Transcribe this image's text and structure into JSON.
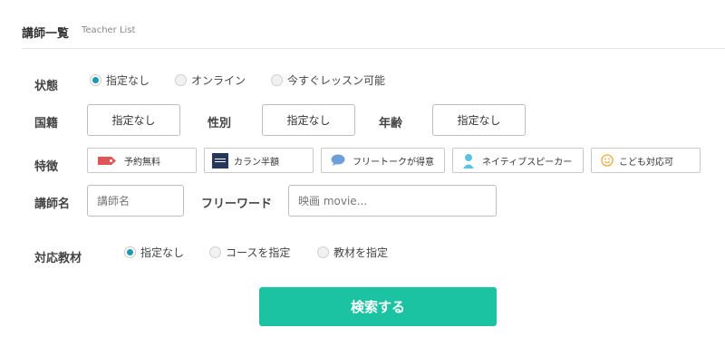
{
  "header": {
    "title": "講師一覧",
    "subtitle": "Teacher List"
  },
  "status": {
    "label": "状態",
    "options": [
      {
        "label": "指定なし",
        "checked": true
      },
      {
        "label": "オンライン",
        "checked": false
      },
      {
        "label": "今すぐレッスン可能",
        "checked": false
      }
    ]
  },
  "nationality": {
    "label": "国籍",
    "value": "指定なし"
  },
  "gender": {
    "label": "性別",
    "value": "指定なし"
  },
  "age": {
    "label": "年齢",
    "value": "指定なし"
  },
  "features": {
    "label": "特徴",
    "items": [
      {
        "label": "予約無料",
        "icon": "red-tag-icon"
      },
      {
        "label": "カラン半額",
        "icon": "callan-logo-icon"
      },
      {
        "label": "フリートークが得意",
        "icon": "speech-bubble-icon"
      },
      {
        "label": "ネイティブスピーカー",
        "icon": "person-icon"
      },
      {
        "label": "こども対応可",
        "icon": "smiley-icon"
      }
    ]
  },
  "teacher_name": {
    "label": "講師名",
    "placeholder": "講師名"
  },
  "free_word": {
    "label": "フリーワード",
    "placeholder": "映画 movie..."
  },
  "materials": {
    "label": "対応教材",
    "options": [
      {
        "label": "指定なし",
        "checked": true
      },
      {
        "label": "コースを指定",
        "checked": false
      },
      {
        "label": "教材を指定",
        "checked": false
      }
    ]
  },
  "search_button": {
    "label": "検索する"
  },
  "colors": {
    "accent": "#1cc3a2",
    "radio": "#1a9bb2"
  }
}
